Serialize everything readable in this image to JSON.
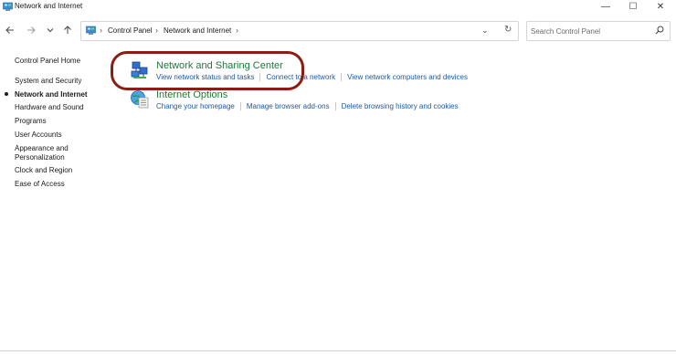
{
  "window": {
    "title": "Network and Internet",
    "controls": {
      "minimize": "—",
      "maximize": "☐",
      "close": "✕"
    }
  },
  "nav": {
    "back_icon": "arrow-left-icon",
    "forward_icon": "arrow-right-icon",
    "recent_icon": "chevron-down-icon",
    "up_icon": "arrow-up-icon"
  },
  "address": {
    "sep_0": "›",
    "crumbs": [
      "Control Panel",
      "Network and Internet"
    ],
    "sep_1": "›",
    "sep_2": "›",
    "dropdown_glyph": "⌄",
    "refresh_glyph": "↻"
  },
  "search": {
    "placeholder": "Search Control Panel",
    "value": ""
  },
  "sidebar": {
    "items": [
      {
        "label": "Control Panel Home"
      },
      {
        "label": "System and Security"
      },
      {
        "label": "Network and Internet",
        "active": true
      },
      {
        "label": "Hardware and Sound"
      },
      {
        "label": "Programs"
      },
      {
        "label": "User Accounts"
      },
      {
        "label": "Appearance and Personalization"
      },
      {
        "label": "Clock and Region"
      },
      {
        "label": "Ease of Access"
      }
    ]
  },
  "categories": [
    {
      "title": "Network and Sharing Center",
      "icon": "network-sharing-icon",
      "links": [
        "View network status and tasks",
        "Connect to a network",
        "View network computers and devices"
      ]
    },
    {
      "title": "Internet Options",
      "icon": "internet-options-icon",
      "links": [
        "Change your homepage",
        "Manage browser add-ons",
        "Delete browsing history and cookies"
      ]
    }
  ],
  "colors": {
    "category_title": "#1e7a3c",
    "link": "#1c5aa6",
    "highlight_ring": "#8b1e12"
  }
}
